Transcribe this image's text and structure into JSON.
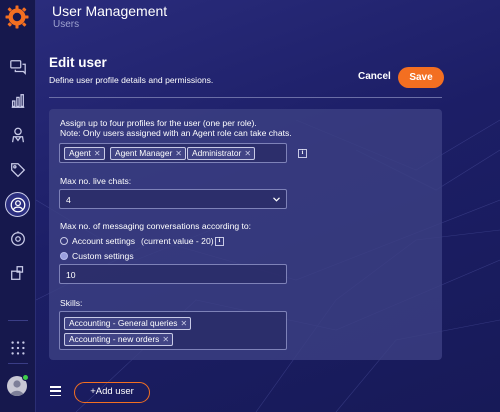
{
  "header": {
    "title": "User Management",
    "subtitle": "Users"
  },
  "edit": {
    "title": "Edit user",
    "description": "Define user profile details and permissions.",
    "cancel_label": "Cancel",
    "save_label": "Save"
  },
  "form": {
    "profiles": {
      "label_line1": "Assign up to four profiles for the user (one per role).",
      "label_line2": "Note: Only users assigned with an Agent role can take chats.",
      "chips": [
        "Agent",
        "Agent Manager",
        "Administrator"
      ],
      "info_icon": "i"
    },
    "max_live_chats": {
      "label": "Max no. live chats:",
      "value": "4"
    },
    "max_messaging": {
      "label": "Max no. of messaging conversations according to:",
      "option_account": "Account settings",
      "option_account_note": "(current value - 20)",
      "option_custom": "Custom settings",
      "selected": "Custom settings",
      "custom_value": "10",
      "info_icon": "i"
    },
    "skills": {
      "label": "Skills:",
      "chips": [
        "Accounting - General queries",
        "Accounting - new orders"
      ]
    }
  },
  "footer": {
    "add_user_label": "+Add user"
  },
  "colors": {
    "accent": "#f36f21",
    "background": "#1c1e5e",
    "panel": "#3c3f82",
    "online": "#3ecf4a"
  },
  "icons": {
    "rail": [
      "chat-icon",
      "analytics-icon",
      "agent-icon",
      "tag-icon",
      "users-icon",
      "bot-icon",
      "integrations-icon",
      "apps-grid-icon"
    ]
  }
}
